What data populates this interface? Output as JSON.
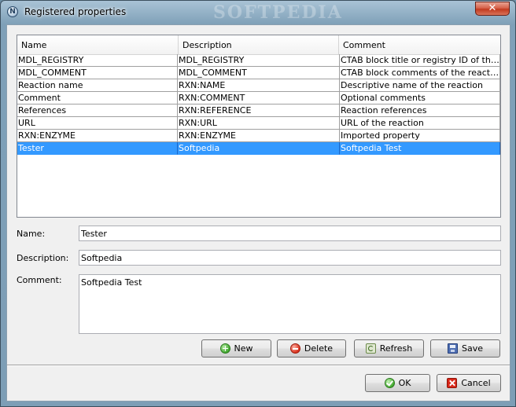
{
  "window": {
    "title": "Registered properties",
    "watermark": "SOFTPEDIA",
    "close_glyph": "✕"
  },
  "table": {
    "columns": [
      "Name",
      "Description",
      "Comment"
    ],
    "rows": [
      {
        "name": "MDL_REGISTRY",
        "description": "MDL_REGISTRY",
        "comment": "CTAB block title or registry ID of the re…",
        "selected": false
      },
      {
        "name": "MDL_COMMENT",
        "description": "MDL_COMMENT",
        "comment": "CTAB block comments of the reaction",
        "selected": false
      },
      {
        "name": "Reaction name",
        "description": "RXN:NAME",
        "comment": "Descriptive name of the reaction",
        "selected": false
      },
      {
        "name": "Comment",
        "description": "RXN:COMMENT",
        "comment": "Optional comments",
        "selected": false
      },
      {
        "name": "References",
        "description": "RXN:REFERENCE",
        "comment": "Reaction references",
        "selected": false
      },
      {
        "name": "URL",
        "description": "RXN:URL",
        "comment": "URL of the reaction",
        "selected": false
      },
      {
        "name": "RXN:ENZYME",
        "description": "RXN:ENZYME",
        "comment": "Imported property",
        "selected": false
      },
      {
        "name": "Tester",
        "description": "Softpedia",
        "comment": "Softpedia Test",
        "selected": true
      }
    ]
  },
  "form": {
    "name_label": "Name:",
    "name_value": "Tester",
    "description_label": "Description:",
    "description_value": "Softpedia",
    "comment_label": "Comment:",
    "comment_value": "Softpedia Test"
  },
  "actions": {
    "new_label": "New",
    "delete_label": "Delete",
    "refresh_label": "Refresh",
    "save_label": "Save"
  },
  "dialog": {
    "ok_label": "OK",
    "cancel_label": "Cancel"
  },
  "colors": {
    "selection": "#3399ff",
    "titlebar": "#7fa0b8"
  }
}
